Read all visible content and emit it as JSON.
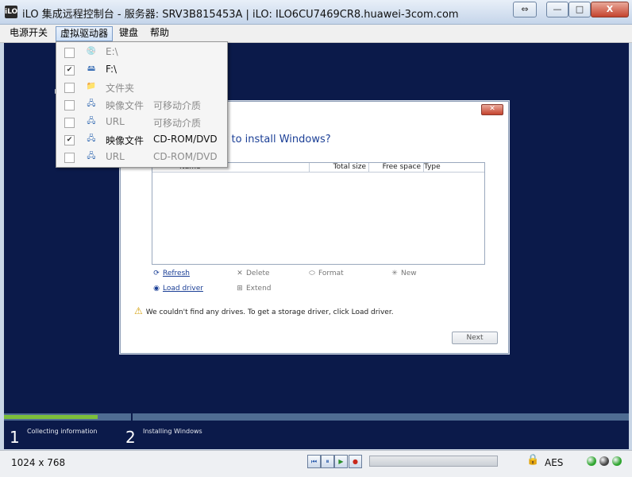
{
  "window": {
    "app_icon_text": "iLO",
    "title": "iLO 集成远程控制台 - 服务器: SRV3B815453A | iLO: ILO6CU7469CR8.huawei-3com.com",
    "restore_app_symbol": "⇔",
    "minimize_symbol": "—",
    "maximize_symbol": "□",
    "close_symbol": "X"
  },
  "menubar": {
    "items": [
      {
        "label": "电源开关"
      },
      {
        "label": "虚拟驱动器"
      },
      {
        "label": "键盘"
      },
      {
        "label": "帮助"
      }
    ]
  },
  "virtual_drive_menu": {
    "items": [
      {
        "checked": false,
        "icon": "floppy-drive-icon",
        "label": "E:\\",
        "type": "",
        "enabled": false
      },
      {
        "checked": true,
        "icon": "usb-drive-icon",
        "label": "F:\\",
        "type": "",
        "enabled": true
      },
      {
        "checked": false,
        "icon": "folder-icon",
        "label": "文件夹",
        "type": "",
        "enabled": false
      },
      {
        "checked": false,
        "icon": "network-drive-icon",
        "label": "映像文件",
        "type": "可移动介质",
        "enabled": false
      },
      {
        "checked": false,
        "icon": "network-drive-icon",
        "label": "URL",
        "type": "可移动介质",
        "enabled": false
      },
      {
        "checked": true,
        "icon": "network-drive-icon",
        "label": "映像文件",
        "type": "CD-ROM/DVD",
        "enabled": true
      },
      {
        "checked": false,
        "icon": "network-drive-icon",
        "label": "URL",
        "type": "CD-ROM/DVD",
        "enabled": false
      }
    ]
  },
  "setup_dialog": {
    "question": "nt to install Windows?",
    "table_headers": {
      "name": "Name",
      "total": "Total size",
      "free": "Free space",
      "type": "Type"
    },
    "actions": {
      "refresh": "Refresh",
      "delete": "Delete",
      "format": "Format",
      "new": "New",
      "load_driver": "Load driver",
      "extend": "Extend"
    },
    "warning": "We couldn't find any drives. To get a storage driver, click Load driver.",
    "next": "Next"
  },
  "install_progress": {
    "fill_fraction": 0.15,
    "steps": [
      {
        "number": "1",
        "label": "Collecting information"
      },
      {
        "number": "2",
        "label": "Installing Windows"
      }
    ]
  },
  "statusbar": {
    "resolution": "1024 x 768",
    "controls": {
      "rewind": "⏮",
      "pause": "⏸",
      "play": "▶",
      "record": "●"
    },
    "encryption": "AES",
    "indicators": [
      {
        "name": "green",
        "color": "#2fa52f"
      },
      {
        "name": "gray",
        "color": "#444444"
      },
      {
        "name": "power",
        "color": "#2fa52f"
      }
    ]
  },
  "colors": {
    "screen_background": "#0b1a4a",
    "progress_fill": "#7cbf3a",
    "link": "#1b3f96"
  }
}
